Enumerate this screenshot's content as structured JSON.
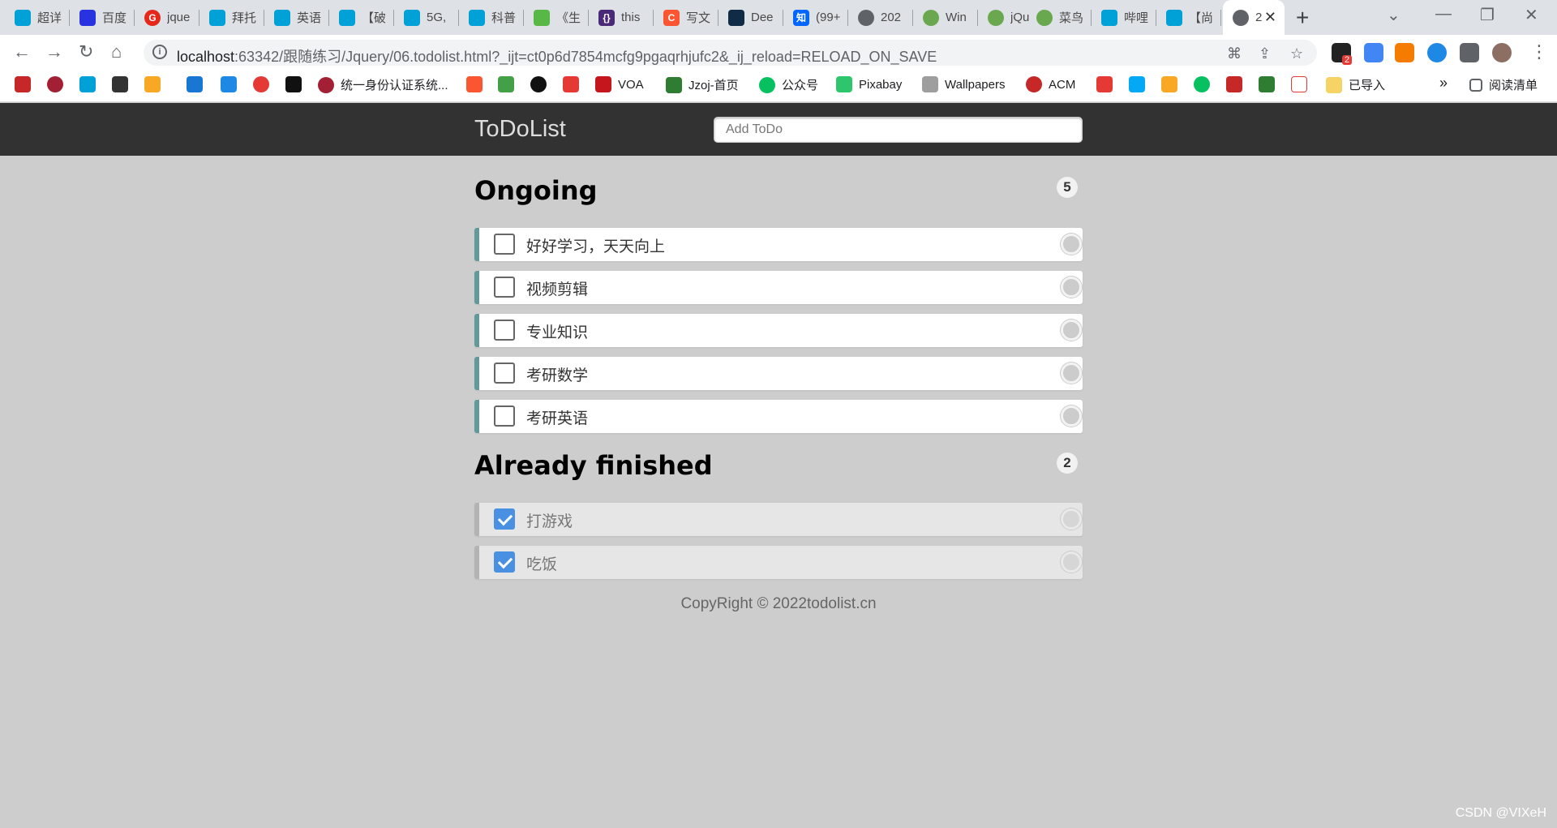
{
  "browser": {
    "tabs": [
      {
        "title": "超详",
        "color": "#00a1d6"
      },
      {
        "title": "百度",
        "color": "#2932e1"
      },
      {
        "title": "jque",
        "color": "#e5281a"
      },
      {
        "title": "拜托",
        "color": "#00a1d6"
      },
      {
        "title": "英语",
        "color": "#00a1d6"
      },
      {
        "title": "【破",
        "color": "#00a1d6"
      },
      {
        "title": "5G,",
        "color": "#00a1d6"
      },
      {
        "title": "科普",
        "color": "#00a1d6"
      },
      {
        "title": "《生",
        "color": "#57b846"
      },
      {
        "title": "this",
        "color": "#4a2a78"
      },
      {
        "title": "写文",
        "color": "#fc5531"
      },
      {
        "title": "Dee",
        "color": "#0f2b46"
      },
      {
        "title": "(99+",
        "color": "#0066ff"
      },
      {
        "title": "202",
        "color": "#5f6368"
      },
      {
        "title": "Win",
        "color": "#6aa84f"
      },
      {
        "title": "jQu",
        "color": "#6aa84f"
      },
      {
        "title": "菜鸟",
        "color": "#6aa84f"
      },
      {
        "title": "哔哩",
        "color": "#00a1d6"
      },
      {
        "title": "【尚",
        "color": "#00a1d6"
      },
      {
        "title": "2",
        "color": "#5f6368"
      }
    ],
    "url_host": "localhost",
    "url_path": ":63342/跟随练习/Jquery/06.todolist.html?_ijt=ct0p6d7854mcfg9pgaqrhjufc2&_ij_reload=RELOAD_ON_SAVE",
    "bookmarks": [
      {
        "label": "统一身份认证系统...",
        "color": "#a31f34"
      },
      {
        "label": "VOA",
        "color": "#c4161c"
      },
      {
        "label": "Jzoj-首页",
        "color": "#2e7d32"
      },
      {
        "label": "公众号",
        "color": "#07c160"
      },
      {
        "label": "Pixabay",
        "color": "#2ec66d"
      },
      {
        "label": "Wallpapers",
        "color": "#555555"
      },
      {
        "label": "ACM",
        "color": "#c62828"
      },
      {
        "label": "已导入",
        "color": "#f6d365"
      },
      {
        "label": "阅读清单",
        "color": "#5f6368"
      }
    ],
    "more_bookmarks": "»",
    "extension_badge": "2"
  },
  "app": {
    "title": "ToDoList",
    "input_placeholder": "Add ToDo"
  },
  "ongoing": {
    "heading": "Ongoing",
    "count": "5",
    "items": [
      "好好学习，天天向上",
      "视频剪辑",
      "专业知识",
      "考研数学",
      "考研英语"
    ]
  },
  "finished": {
    "heading": "Already finished",
    "count": "2",
    "items": [
      "打游戏",
      "吃饭"
    ]
  },
  "footer": "CopyRight © 2022todolist.cn",
  "watermark": "CSDN @VIXeH"
}
